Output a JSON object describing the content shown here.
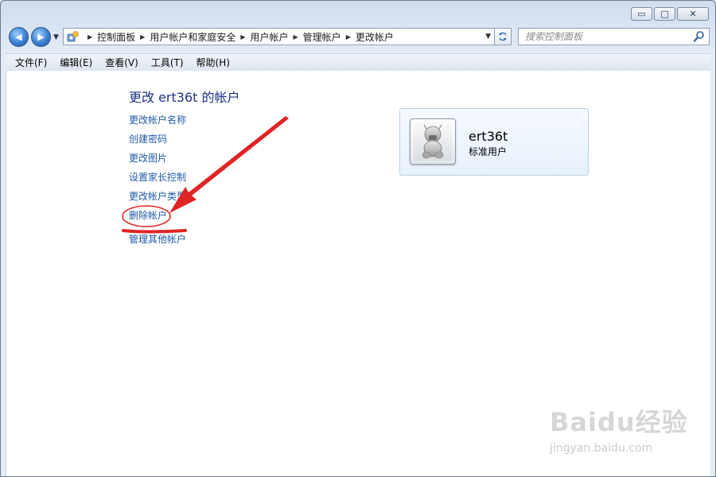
{
  "window": {
    "caption_buttons": {
      "minimize": "▭",
      "maximize": "□",
      "close": "✕"
    }
  },
  "nav": {
    "back_glyph": "◀",
    "forward_glyph": "▶",
    "breadcrumb": [
      {
        "label": "控制面板"
      },
      {
        "label": "用户帐户和家庭安全"
      },
      {
        "label": "用户帐户"
      },
      {
        "label": "管理帐户"
      },
      {
        "label": "更改帐户"
      }
    ],
    "search_placeholder": "搜索控制面板"
  },
  "menu": {
    "items": [
      "文件(F)",
      "编辑(E)",
      "查看(V)",
      "工具(T)",
      "帮助(H)"
    ]
  },
  "main": {
    "title": "更改 ert36t 的帐户",
    "links": [
      "更改帐户名称",
      "创建密码",
      "更改图片",
      "设置家长控制",
      "更改帐户类型",
      "删除帐户"
    ],
    "extra_link": "管理其他帐户",
    "account": {
      "name": "ert36t",
      "type": "标准用户"
    }
  },
  "annotation": {
    "color": "#e02424",
    "highlighted_link": "删除帐户"
  },
  "watermark": {
    "logo": "Baidu经验",
    "url": "jingyan.baidu.com"
  },
  "icons": [
    "back-arrow-icon",
    "forward-arrow-icon",
    "control-panel-icon",
    "refresh-icon",
    "search-icon",
    "user-avatar-icon"
  ]
}
